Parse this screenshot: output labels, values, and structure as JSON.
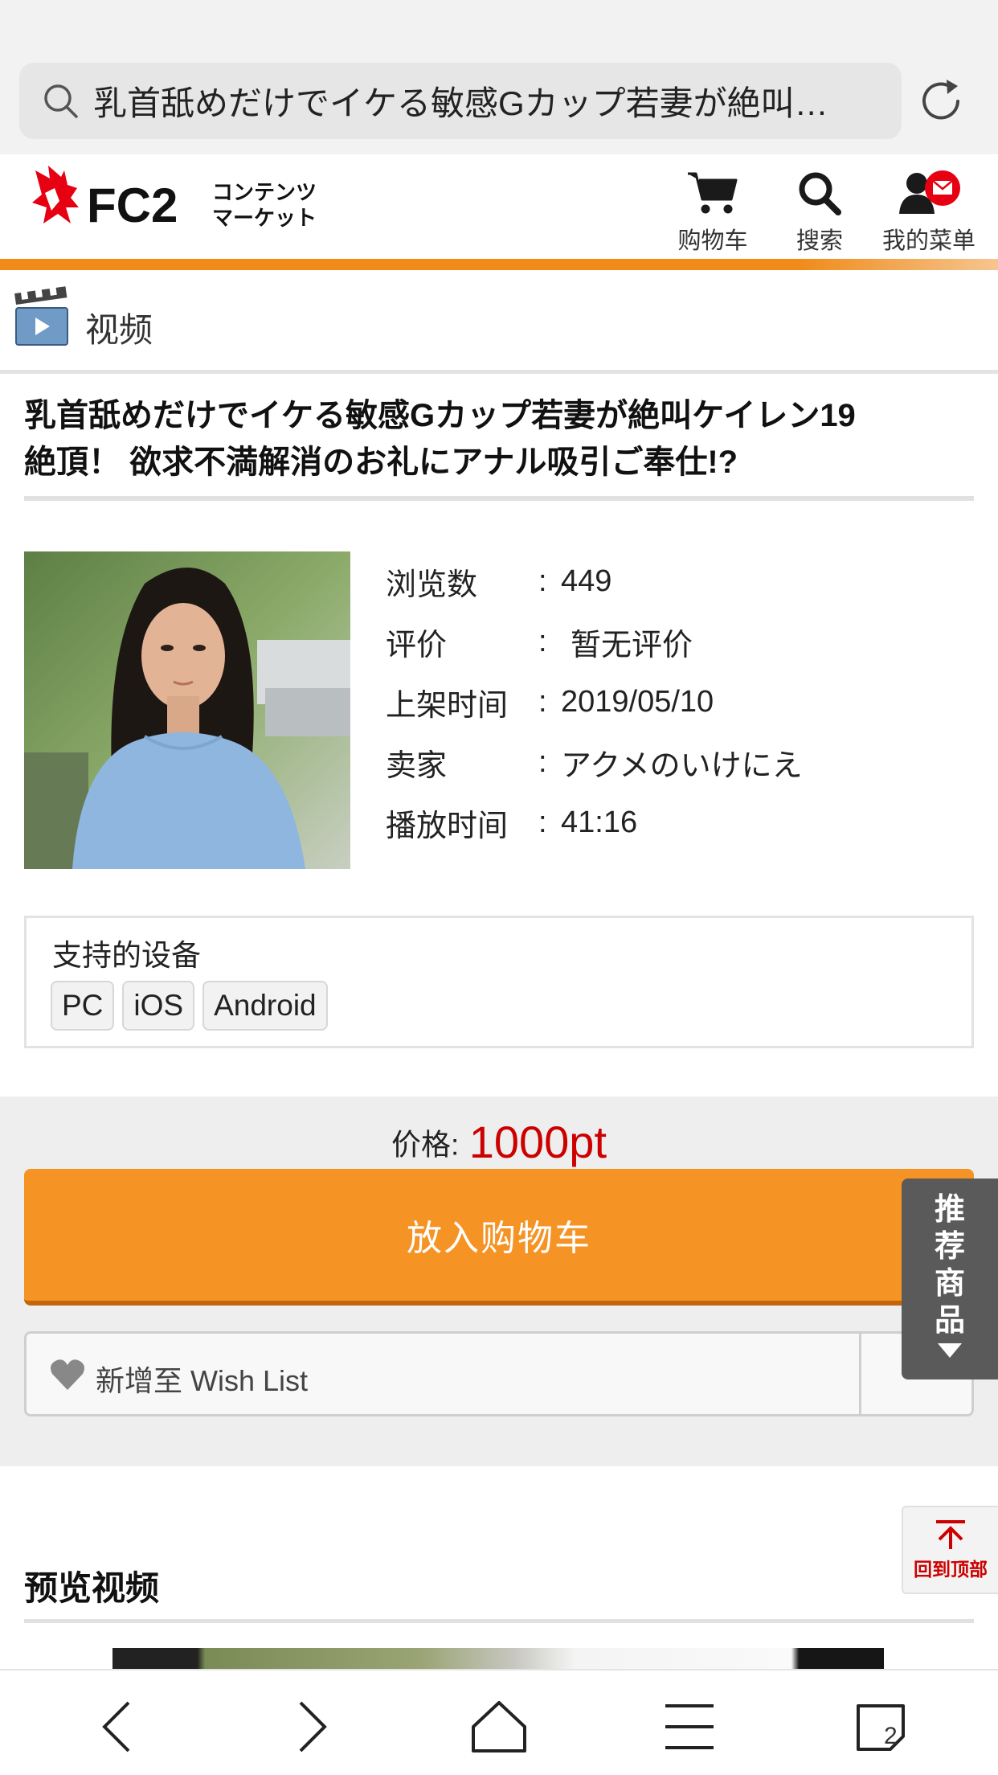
{
  "browser": {
    "url_text": "乳首舐めだけでイケる敏感Gカップ若妻が絶叫…",
    "tab_count": "2"
  },
  "header": {
    "logo_text": "FC2",
    "logo_sub_line1": "コンテンツ",
    "logo_sub_line2": "マーケット",
    "cart_label": "购物车",
    "search_label": "搜索",
    "menu_label": "我的菜单"
  },
  "category": {
    "label": "视频"
  },
  "product": {
    "title_line1": "乳首舐めだけでイケる敏感Gカップ若妻が絶叫ケイレン19",
    "title_line2": "絶頂！ 欲求不満解消のお礼にアナル吸引ご奉仕!?"
  },
  "info": [
    {
      "label": "浏览数",
      "value": "449"
    },
    {
      "label": "评价",
      "value": "暂无评价"
    },
    {
      "label": "上架时间",
      "value": "2019/05/10"
    },
    {
      "label": "卖家",
      "value": "アクメのいけにえ"
    },
    {
      "label": "播放时间",
      "value": "41:16"
    }
  ],
  "devices": {
    "title": "支持的设备",
    "tags": [
      "PC",
      "iOS",
      "Android"
    ]
  },
  "purchase": {
    "price_label": "价格:",
    "price_value": "1000pt",
    "cart_button": "放入购物车",
    "wishlist_button": "新增至 Wish List"
  },
  "side": {
    "recommend": "推\n荐\n商\n品",
    "back_to_top": "回到顶部"
  },
  "preview": {
    "heading": "预览视频"
  },
  "colors": {
    "accent_orange": "#f59324",
    "price_red": "#cc0000",
    "logo_red": "#e60012"
  }
}
